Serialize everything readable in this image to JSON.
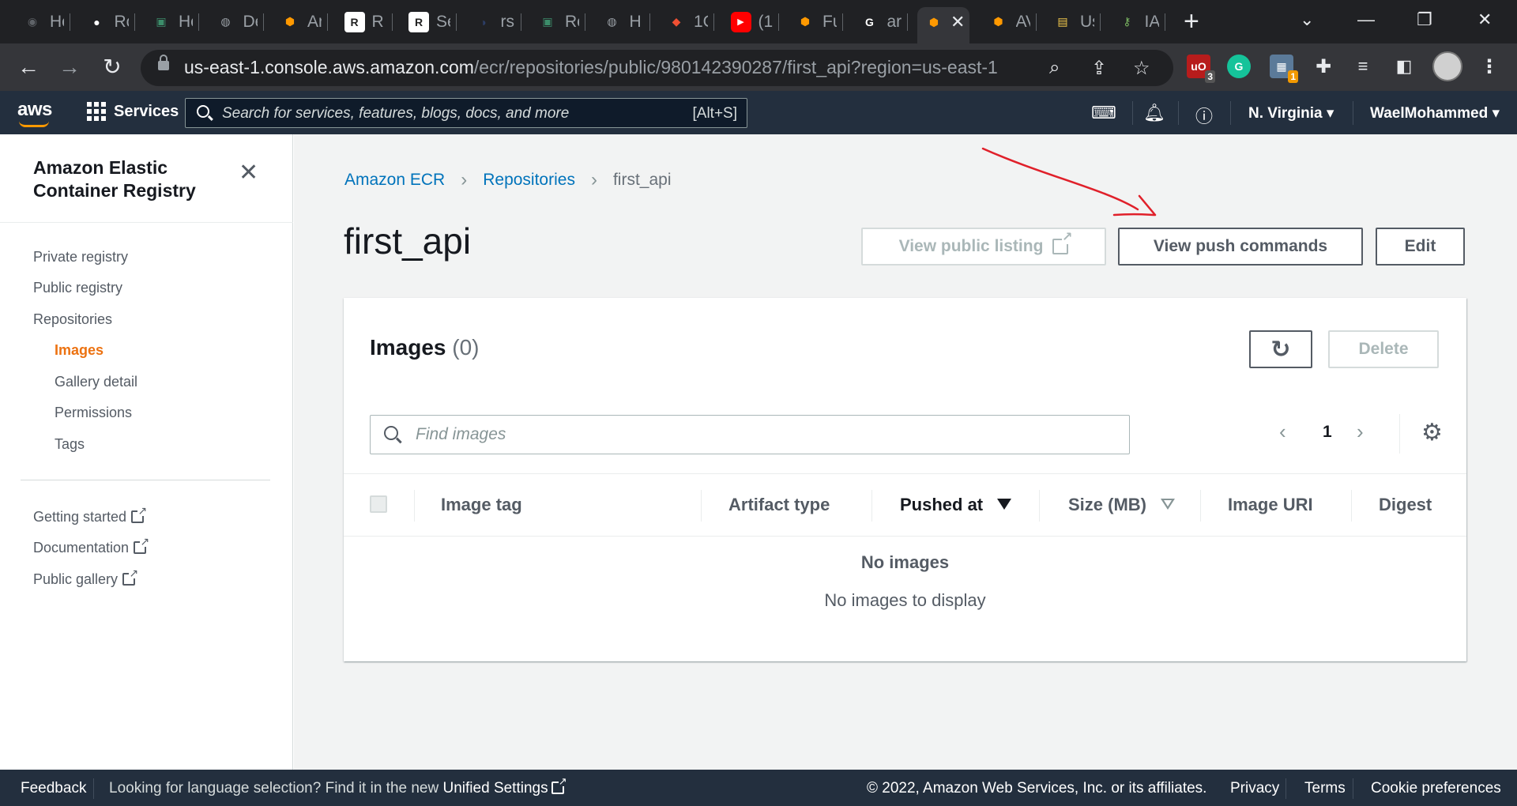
{
  "browser": {
    "tabs": [
      {
        "label": "Hc",
        "icon": "aws-icon",
        "color": "#5f6368"
      },
      {
        "label": "Rc",
        "icon": "github-icon",
        "color": "#ffffff"
      },
      {
        "label": "Hc",
        "icon": "hub-icon",
        "color": "#3c8d6a"
      },
      {
        "label": "De",
        "icon": "globe-icon",
        "color": "#9aa0a6"
      },
      {
        "label": "Ar",
        "icon": "aws-box-icon",
        "color": "#ff9900"
      },
      {
        "label": "R",
        "icon": "render-icon",
        "color": "#ffffff"
      },
      {
        "label": "Se",
        "icon": "render-icon",
        "color": "#ffffff"
      },
      {
        "label": "rs",
        "icon": "docker-icon",
        "color": "#2c3e66"
      },
      {
        "label": "Rc",
        "icon": "hub-icon",
        "color": "#3c8d6a"
      },
      {
        "label": "H",
        "icon": "globe-icon",
        "color": "#9aa0a6"
      },
      {
        "label": "1C",
        "icon": "git-icon",
        "color": "#f05033"
      },
      {
        "label": "(1",
        "icon": "youtube-icon",
        "color": "#ff0000"
      },
      {
        "label": "Fu",
        "icon": "aws-box-icon",
        "color": "#ff9900"
      },
      {
        "label": "ar",
        "icon": "google-icon",
        "color": "#ffffff"
      },
      {
        "label": "",
        "icon": "aws-box-icon",
        "color": "#ff9900",
        "active": true
      },
      {
        "label": "AV",
        "icon": "aws-box-icon",
        "color": "#ff9900"
      },
      {
        "label": "Us",
        "icon": "package-icon",
        "color": "#f2c94c"
      },
      {
        "label": "IA",
        "icon": "key-icon",
        "color": "#7bb661"
      }
    ],
    "url_host": "us-east-1.console.aws.amazon.com",
    "url_path": "/ecr/repositories/public/980142390287/first_api?region=us-east-1",
    "ext_badges": {
      "ublock": "3",
      "ext": "1"
    }
  },
  "aws_nav": {
    "logo": "aws",
    "services": "Services",
    "search_placeholder": "Search for services, features, blogs, docs, and more",
    "search_shortcut": "[Alt+S]",
    "region": "N. Virginia",
    "user": "WaelMohammed"
  },
  "side": {
    "title": "Amazon Elastic Container Registry",
    "items": [
      {
        "label": "Private registry"
      },
      {
        "label": "Public registry"
      },
      {
        "label": "Repositories"
      },
      {
        "label": "Images",
        "active": true
      },
      {
        "label": "Gallery detail"
      },
      {
        "label": "Permissions"
      },
      {
        "label": "Tags"
      }
    ],
    "links": [
      {
        "label": "Getting started"
      },
      {
        "label": "Documentation"
      },
      {
        "label": "Public gallery"
      }
    ]
  },
  "main": {
    "breadcrumb": [
      "Amazon ECR",
      "Repositories",
      "first_api"
    ],
    "title": "first_api",
    "buttons": {
      "view_public": "View public listing",
      "push_commands": "View push commands",
      "edit": "Edit"
    },
    "images": {
      "title": "Images",
      "count": "(0)",
      "delete": "Delete",
      "filter_placeholder": "Find images",
      "page": "1",
      "columns": [
        "Image tag",
        "Artifact type",
        "Pushed at",
        "Size (MB)",
        "Image URI",
        "Digest"
      ],
      "empty_title": "No images",
      "empty_sub": "No images to display"
    }
  },
  "footer": {
    "feedback": "Feedback",
    "lang_text": "Looking for language selection? Find it in the new",
    "unified": "Unified Settings",
    "copyright": "© 2022, Amazon Web Services, Inc. or its affiliates.",
    "privacy": "Privacy",
    "terms": "Terms",
    "cookies": "Cookie preferences"
  },
  "colors": {
    "aws_nav": "#232f3e",
    "link": "#0073bb",
    "active": "#ec7211",
    "annotation": "#e0202a"
  }
}
